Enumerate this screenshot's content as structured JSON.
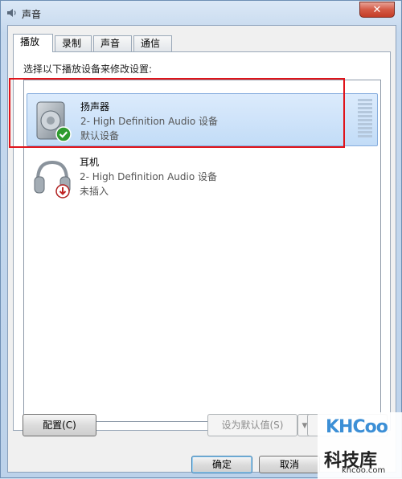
{
  "window": {
    "title": "声音",
    "close_symbol": "✕"
  },
  "tabs": [
    {
      "label": "播放",
      "active": true
    },
    {
      "label": "录制",
      "active": false
    },
    {
      "label": "声音",
      "active": false
    },
    {
      "label": "通信",
      "active": false
    }
  ],
  "instruction": "选择以下播放设备来修改设置:",
  "devices": [
    {
      "name": "扬声器",
      "description": "2- High Definition Audio 设备",
      "status": "默认设备",
      "icon": "speaker-icon",
      "badge": "green-check",
      "selected": true
    },
    {
      "name": "耳机",
      "description": "2- High Definition Audio 设备",
      "status": "未插入",
      "icon": "headphones-icon",
      "badge": "red-down-arrow",
      "selected": false
    }
  ],
  "buttons": {
    "configure": "配置(C)",
    "set_default": "设为默认值(S)",
    "ok": "确定",
    "cancel": "取消"
  },
  "watermark": {
    "logo": "KHCoo",
    "cn": "科技库",
    "url": "khcoo.com"
  },
  "colors": {
    "annotation": "#e0141b",
    "selection": "#c2dcf7"
  }
}
